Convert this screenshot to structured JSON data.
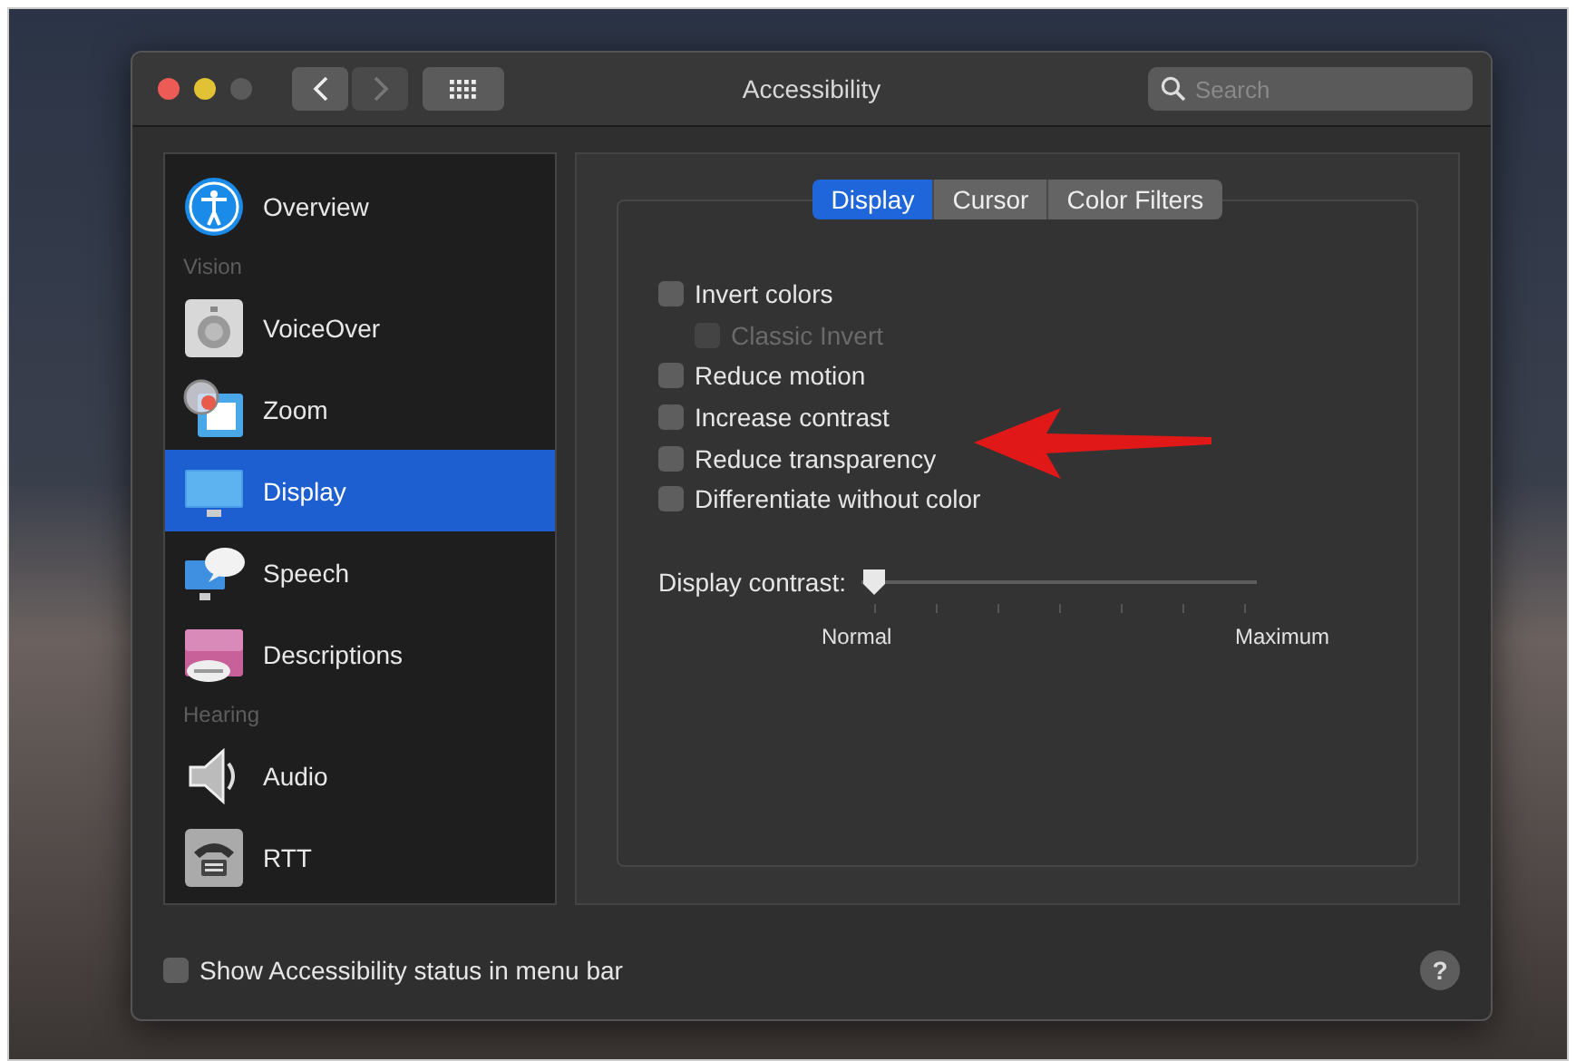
{
  "window": {
    "title": "Accessibility",
    "traffic_lights": [
      {
        "color": "#ec5b55"
      },
      {
        "color": "#e0c234"
      },
      {
        "color": "#5a5a5a"
      }
    ]
  },
  "search": {
    "placeholder": "Search"
  },
  "sidebar": {
    "items": [
      {
        "kind": "item",
        "label": "Overview",
        "selected": false
      },
      {
        "kind": "section",
        "label": "Vision"
      },
      {
        "kind": "item",
        "label": "VoiceOver",
        "selected": false
      },
      {
        "kind": "item",
        "label": "Zoom",
        "selected": false
      },
      {
        "kind": "item",
        "label": "Display",
        "selected": true
      },
      {
        "kind": "item",
        "label": "Speech",
        "selected": false
      },
      {
        "kind": "item",
        "label": "Descriptions",
        "selected": false
      },
      {
        "kind": "section",
        "label": "Hearing"
      },
      {
        "kind": "item",
        "label": "Audio",
        "selected": false
      },
      {
        "kind": "item",
        "label": "RTT",
        "selected": false
      }
    ]
  },
  "tabs": [
    {
      "label": "Display",
      "selected": true
    },
    {
      "label": "Cursor",
      "selected": false
    },
    {
      "label": "Color Filters",
      "selected": false
    }
  ],
  "options": [
    {
      "label": "Invert colors",
      "checked": false,
      "disabled": false,
      "children": [
        {
          "label": "Classic Invert",
          "checked": false,
          "disabled": true
        }
      ]
    },
    {
      "label": "Reduce motion",
      "checked": false,
      "disabled": false
    },
    {
      "label": "Increase contrast",
      "checked": false,
      "disabled": false
    },
    {
      "label": "Reduce transparency",
      "checked": false,
      "disabled": false
    },
    {
      "label": "Differentiate without color",
      "checked": false,
      "disabled": false
    }
  ],
  "contrast_slider": {
    "label": "Display contrast:",
    "level": 0,
    "min_label": "Normal",
    "max_label": "Maximum"
  },
  "footer": {
    "status_checkbox": {
      "label": "Show Accessibility status in menu bar",
      "checked": false
    },
    "help": "?"
  }
}
